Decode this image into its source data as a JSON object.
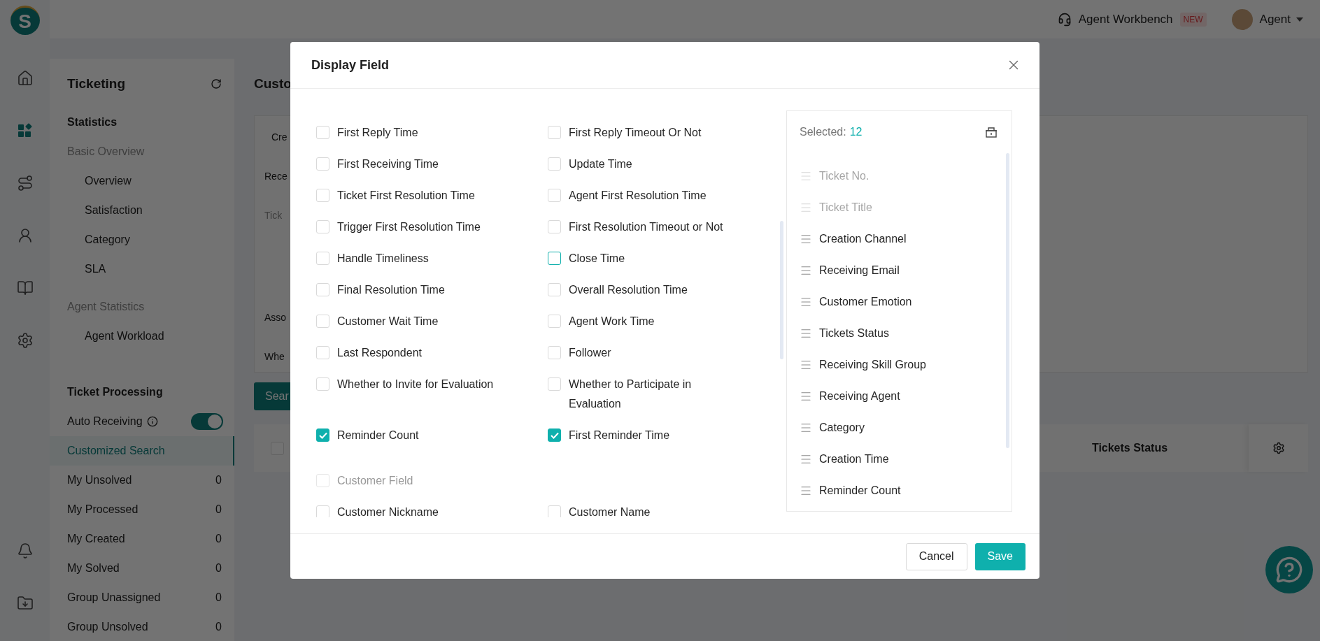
{
  "logo": "S",
  "topbar": {
    "workbench": "Agent Workbench",
    "badge": "NEW",
    "user": "Agent"
  },
  "rail": [
    {
      "kind": "home",
      "selected": false
    },
    {
      "kind": "apps",
      "selected": true
    },
    {
      "kind": "route",
      "selected": false
    },
    {
      "kind": "user",
      "selected": false
    },
    {
      "kind": "book",
      "selected": false
    },
    {
      "kind": "settings",
      "selected": false
    },
    {
      "kind": "bell",
      "selected": false
    },
    {
      "kind": "download",
      "selected": false
    }
  ],
  "sidebar": {
    "title": "Ticketing",
    "statistics": {
      "title": "Statistics",
      "groups": [
        {
          "label": "Basic Overview",
          "children": [
            {
              "label": "Overview",
              "selected": false
            },
            {
              "label": "Satisfaction",
              "selected": false
            },
            {
              "label": "Category",
              "selected": false
            },
            {
              "label": "SLA",
              "selected": false
            }
          ]
        },
        {
          "label": "Agent Statistics",
          "children": [
            {
              "label": "Agent Workload",
              "selected": false
            }
          ]
        }
      ]
    },
    "processing": {
      "title": "Ticket Processing",
      "auto_receiving": {
        "label": "Auto Receiving",
        "on": true
      },
      "items": [
        {
          "label": "Customized Search",
          "selected": true
        },
        {
          "label": "My Unsolved",
          "count": "0",
          "selected": false
        },
        {
          "label": "My Processed",
          "count": "0",
          "selected": false
        },
        {
          "label": "My Created",
          "count": "0",
          "selected": false
        },
        {
          "label": "My Solved",
          "count": "0",
          "selected": false
        },
        {
          "label": "Group Unassigned",
          "count": "0",
          "selected": false
        },
        {
          "label": "Group Unsolved",
          "count": "0",
          "selected": false
        }
      ]
    }
  },
  "content": {
    "title": "Custo",
    "filters": [
      {
        "label": "Cre",
        "kind": "tab"
      },
      {
        "label": "Rece",
        "kind": "field"
      },
      {
        "label": "Tick",
        "kind": "heading"
      },
      {
        "label": "Asso",
        "kind": "field"
      },
      {
        "label": "Whe",
        "kind": "field"
      }
    ],
    "search_button": "Sear",
    "table": {
      "all_checked": false,
      "columns": [
        "Tickets Status"
      ]
    }
  },
  "dialog": {
    "title": "Display Field",
    "fields": [
      {
        "kind": "field",
        "label": "First Reply Time",
        "checked": false,
        "hover": false
      },
      {
        "kind": "field",
        "label": "First Reply Timeout Or Not",
        "checked": false,
        "hover": false
      },
      {
        "kind": "field",
        "label": "First Receiving Time",
        "checked": false,
        "hover": false
      },
      {
        "kind": "field",
        "label": "Update Time",
        "checked": false,
        "hover": false
      },
      {
        "kind": "field",
        "label": "Ticket First Resolution Time",
        "checked": false,
        "hover": false
      },
      {
        "kind": "field",
        "label": "Agent First Resolution Time",
        "checked": false,
        "hover": false
      },
      {
        "kind": "field",
        "label": "Trigger First Resolution Time",
        "checked": false,
        "hover": false
      },
      {
        "kind": "field",
        "label": "First Resolution Timeout or Not",
        "checked": false,
        "hover": false
      },
      {
        "kind": "field",
        "label": "Handle Timeliness",
        "checked": false,
        "hover": false
      },
      {
        "kind": "field",
        "label": "Close Time",
        "checked": false,
        "hover": true
      },
      {
        "kind": "field",
        "label": "Final Resolution Time",
        "checked": false,
        "hover": false
      },
      {
        "kind": "field",
        "label": "Overall Resolution Time",
        "checked": false,
        "hover": false
      },
      {
        "kind": "field",
        "label": "Customer Wait Time",
        "checked": false,
        "hover": false
      },
      {
        "kind": "field",
        "label": "Agent Work Time",
        "checked": false,
        "hover": false
      },
      {
        "kind": "field",
        "label": "Last Respondent",
        "checked": false,
        "hover": false
      },
      {
        "kind": "field",
        "label": "Follower",
        "checked": false,
        "hover": false
      },
      {
        "kind": "field",
        "label": "Whether to Invite for Evaluation",
        "checked": false,
        "hover": false
      },
      {
        "kind": "field",
        "label": "Whether to Participate in Evaluation",
        "checked": false,
        "hover": false
      },
      {
        "kind": "field",
        "label": "Reminder Count",
        "checked": true,
        "hover": false
      },
      {
        "kind": "field",
        "label": "First Reminder Time",
        "checked": true,
        "hover": false
      },
      {
        "kind": "group",
        "label": "Customer Field",
        "checked": false,
        "hover": false
      },
      {
        "kind": "field",
        "label": "Customer Nickname",
        "checked": false,
        "hover": false
      },
      {
        "kind": "field",
        "label": "Customer Name",
        "checked": false,
        "hover": false
      }
    ],
    "selected_label": "Selected:",
    "selected_count": "12",
    "selected_fields": [
      {
        "label": "Ticket No.",
        "locked": true
      },
      {
        "label": "Ticket Title",
        "locked": true
      },
      {
        "label": "Creation Channel",
        "locked": false
      },
      {
        "label": "Receiving Email",
        "locked": false
      },
      {
        "label": "Customer Emotion",
        "locked": false
      },
      {
        "label": "Tickets Status",
        "locked": false
      },
      {
        "label": "Receiving Skill Group",
        "locked": false
      },
      {
        "label": "Receiving Agent",
        "locked": false
      },
      {
        "label": "Category",
        "locked": false
      },
      {
        "label": "Creation Time",
        "locked": false
      },
      {
        "label": "Reminder Count",
        "locked": false
      }
    ],
    "cancel": "Cancel",
    "save": "Save"
  }
}
